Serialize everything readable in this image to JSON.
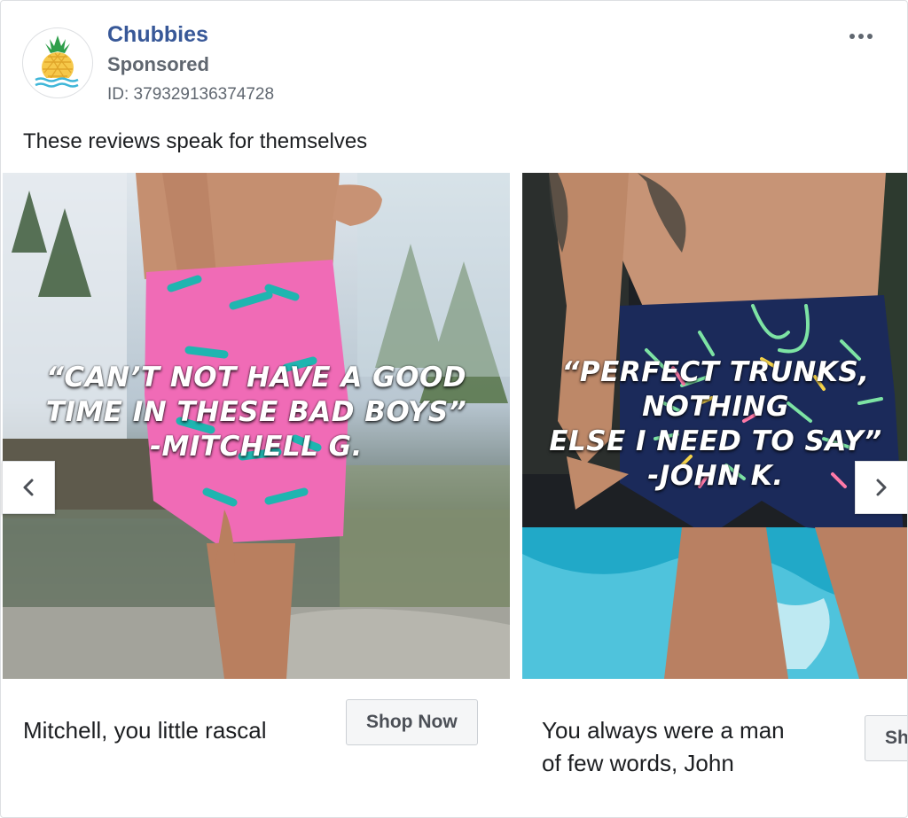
{
  "advertiser": {
    "name": "Chubbies",
    "sponsored_label": "Sponsored",
    "ad_id": "ID: 379329136374728",
    "logo_icon": "pineapple-wave-logo"
  },
  "post": {
    "primary_text": "These reviews speak for themselves"
  },
  "carousel": {
    "cards": [
      {
        "image_quote": "“CAN’T NOT HAVE A GOOD\nTIME IN THESE BAD BOYS”\n-MITCHELL G.",
        "caption": "Mitchell, you little rascal",
        "cta_label": "Shop Now"
      },
      {
        "image_quote": "“PERFECT TRUNKS, NOTHING\nELSE I NEED TO SAY”\n-JOHN K.",
        "caption": "You always were a man\nof few words, John",
        "cta_label": "Shop Now"
      }
    ],
    "prev_icon": "chevron-left-icon",
    "next_icon": "chevron-right-icon"
  },
  "colors": {
    "brand_link": "#385898",
    "secondary_text": "#606770",
    "shorts_pink": "#f06bb6",
    "shorts_navy": "#1b2a5a"
  }
}
